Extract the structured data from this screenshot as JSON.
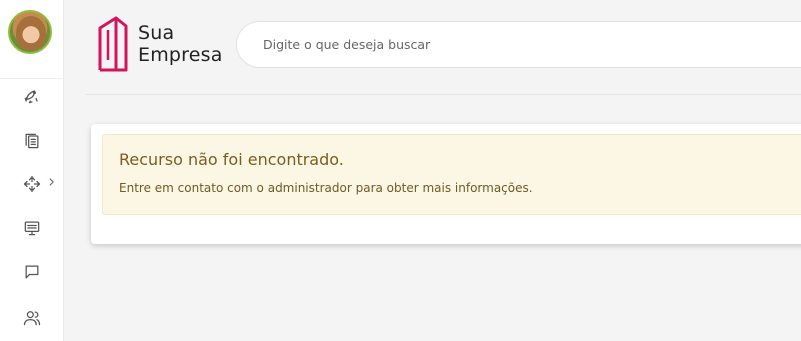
{
  "sidebar": {
    "avatar_label": "",
    "items": [
      {
        "icon": "rocket-icon"
      },
      {
        "icon": "documents-icon"
      },
      {
        "icon": "network-icon",
        "has_submenu": true
      },
      {
        "icon": "monitor-icon"
      },
      {
        "icon": "chat-icon"
      },
      {
        "icon": "users-icon"
      }
    ]
  },
  "header": {
    "brand_line1": "Sua",
    "brand_line2": "Empresa",
    "brand_color": "#d4145a",
    "search_placeholder": "Digite o que deseja buscar"
  },
  "alert": {
    "title": "Recurso não foi encontrado.",
    "message": "Entre em contato com o administrador para obter mais informações.",
    "background": "#fcf7e4",
    "title_color": "#7a5d1e"
  }
}
